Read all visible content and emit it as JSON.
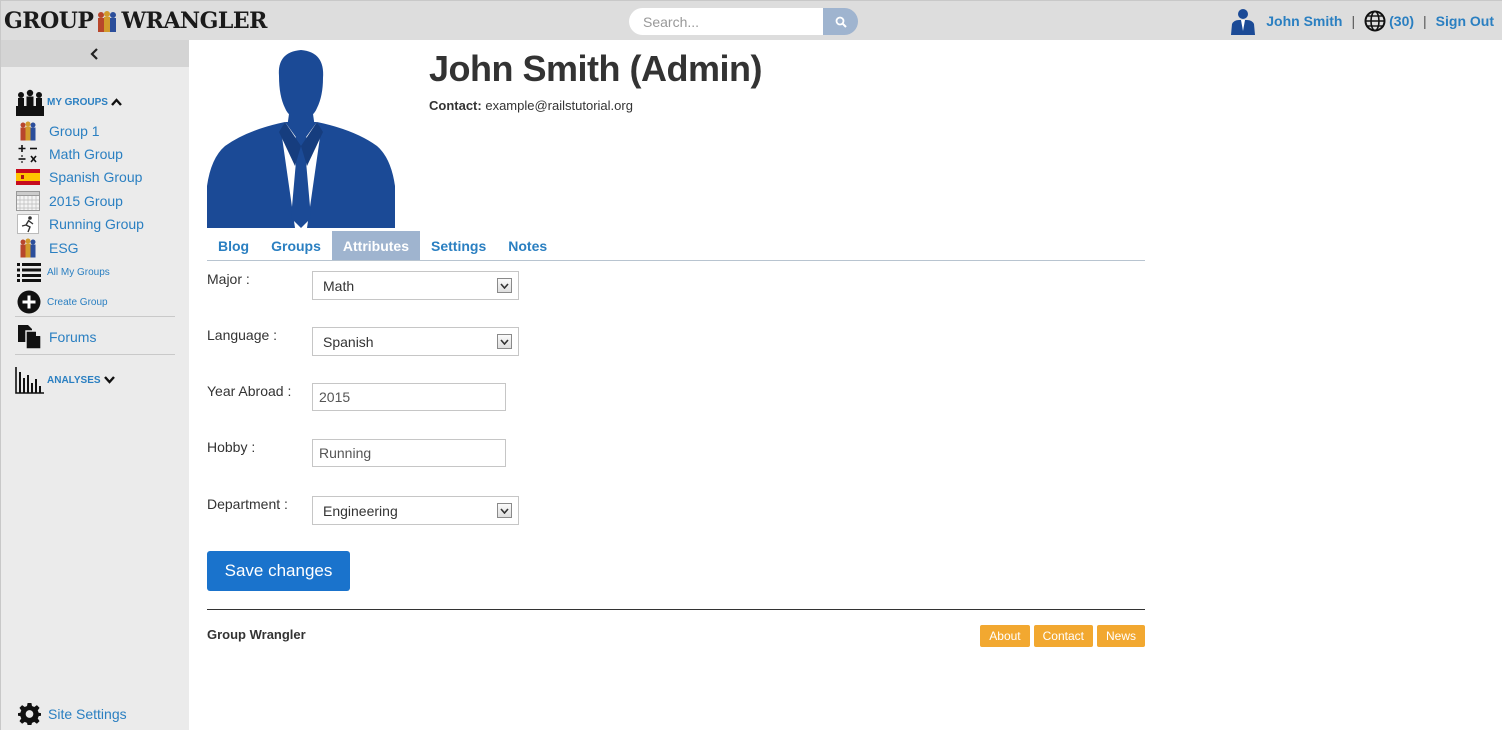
{
  "header": {
    "logo_left": "GROUP",
    "logo_right": "WRANGLER",
    "search_placeholder": "Search...",
    "user_name": "John Smith",
    "notifications": "(30)",
    "sign_out": "Sign Out",
    "separator": "|"
  },
  "sidebar": {
    "my_groups_label": "MY GROUPS",
    "groups": [
      {
        "label": "Group 1",
        "icon": "people-icon"
      },
      {
        "label": "Math Group",
        "icon": "math-icon"
      },
      {
        "label": "Spanish Group",
        "icon": "spain-flag-icon"
      },
      {
        "label": "2015 Group",
        "icon": "calendar-icon"
      },
      {
        "label": "Running Group",
        "icon": "runner-icon"
      },
      {
        "label": "ESG",
        "icon": "people-icon"
      }
    ],
    "all_groups": "All My Groups",
    "create_group": "Create Group",
    "forums": "Forums",
    "analyses_label": "ANALYSES",
    "site_settings": "Site Settings"
  },
  "profile": {
    "name": "John Smith (Admin)",
    "contact_label": "Contact:",
    "contact_email": "example@railstutorial.org"
  },
  "tabs": [
    {
      "label": "Blog",
      "active": false
    },
    {
      "label": "Groups",
      "active": false
    },
    {
      "label": "Attributes",
      "active": true
    },
    {
      "label": "Settings",
      "active": false
    },
    {
      "label": "Notes",
      "active": false
    }
  ],
  "form": {
    "major_label": "Major :",
    "major_value": "Math",
    "language_label": "Language :",
    "language_value": "Spanish",
    "year_label": "Year Abroad :",
    "year_value": "2015",
    "hobby_label": "Hobby :",
    "hobby_value": "Running",
    "department_label": "Department :",
    "department_value": "Engineering",
    "save_label": "Save changes"
  },
  "footer": {
    "title": "Group Wrangler",
    "links": [
      "About",
      "Contact",
      "News"
    ]
  },
  "colors": {
    "link": "#2a7fc1",
    "tab_active": "#9fb4cf",
    "save_button": "#1a73cc",
    "footer_link": "#f2a830",
    "silhouette": "#1b4a96"
  }
}
